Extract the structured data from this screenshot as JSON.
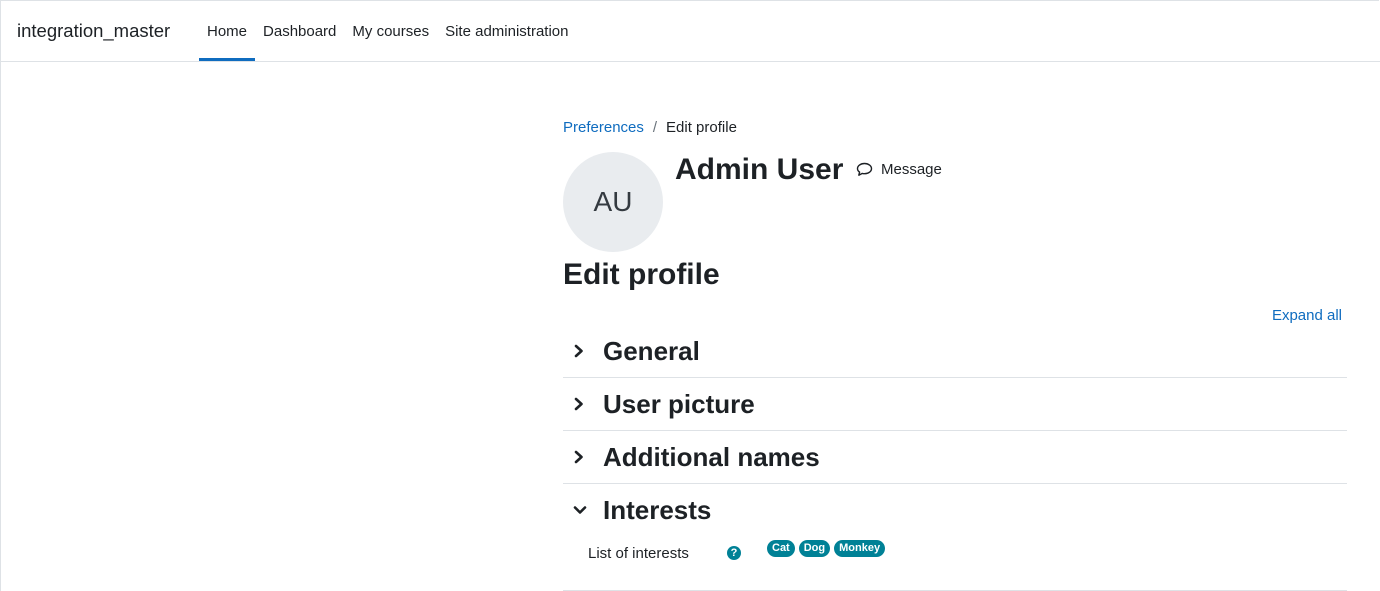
{
  "navbar": {
    "brand": "integration_master",
    "items": [
      {
        "label": "Home",
        "active": true
      },
      {
        "label": "Dashboard",
        "active": false
      },
      {
        "label": "My courses",
        "active": false
      },
      {
        "label": "Site administration",
        "active": false
      }
    ]
  },
  "breadcrumb": {
    "parent": "Preferences",
    "separator": "/",
    "current": "Edit profile"
  },
  "user": {
    "initials": "AU",
    "name": "Admin User",
    "message_label": "Message"
  },
  "page_title": "Edit profile",
  "expand_all": "Expand all",
  "sections": [
    {
      "title": "General",
      "expanded": false
    },
    {
      "title": "User picture",
      "expanded": false
    },
    {
      "title": "Additional names",
      "expanded": false
    },
    {
      "title": "Interests",
      "expanded": true
    }
  ],
  "interests": {
    "label": "List of interests",
    "help_icon": "?",
    "tags": [
      "Cat",
      "Dog",
      "Monkey"
    ]
  },
  "colors": {
    "accent": "#0f6cbf",
    "tag": "#008196"
  }
}
